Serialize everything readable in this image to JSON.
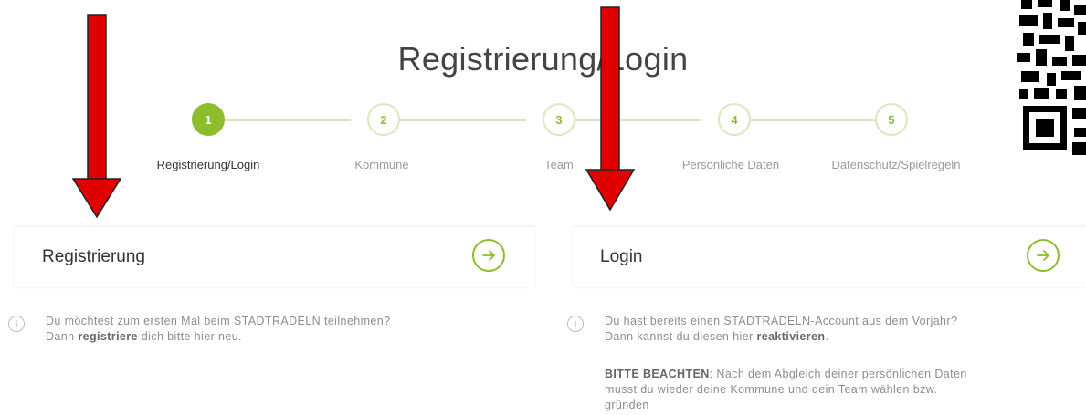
{
  "page": {
    "title": "Registrierung/Login"
  },
  "stepper": {
    "steps": [
      {
        "number": "1",
        "label": "Registrierung/Login",
        "active": true
      },
      {
        "number": "2",
        "label": "Kommune",
        "active": false
      },
      {
        "number": "3",
        "label": "Team",
        "active": false
      },
      {
        "number": "4",
        "label": "Persönliche Daten",
        "active": false
      },
      {
        "number": "5",
        "label": "Datenschutz/Spielregeln",
        "active": false
      }
    ]
  },
  "register": {
    "title": "Registrierung",
    "info_line1": "Du möchtest zum ersten Mal beim STADTRADELN teilnehmen?",
    "info_line2_pre": "Dann ",
    "info_line2_bold": "registriere",
    "info_line2_post": " dich bitte hier neu."
  },
  "login": {
    "title": "Login",
    "info_line1": "Du hast bereits einen STADTRADELN-Account aus dem Vorjahr?",
    "info_line2_pre": "Dann kannst du diesen hier ",
    "info_line2_bold": "reaktivieren",
    "info_line2_post": ".",
    "note_bold": "BITTE BEACHTEN",
    "note_line1": ": Nach dem Abgleich deiner persönlichen Daten",
    "note_line2": "musst du wieder deine Kommune und dein Team wählen bzw.",
    "note_line3": "gründen"
  },
  "colors": {
    "accent": "#8cbd2c",
    "annotation_arrow": "#e00000"
  },
  "icons": [
    "arrow-right-icon",
    "info-icon",
    "red-annotation-arrow",
    "qr-code"
  ]
}
